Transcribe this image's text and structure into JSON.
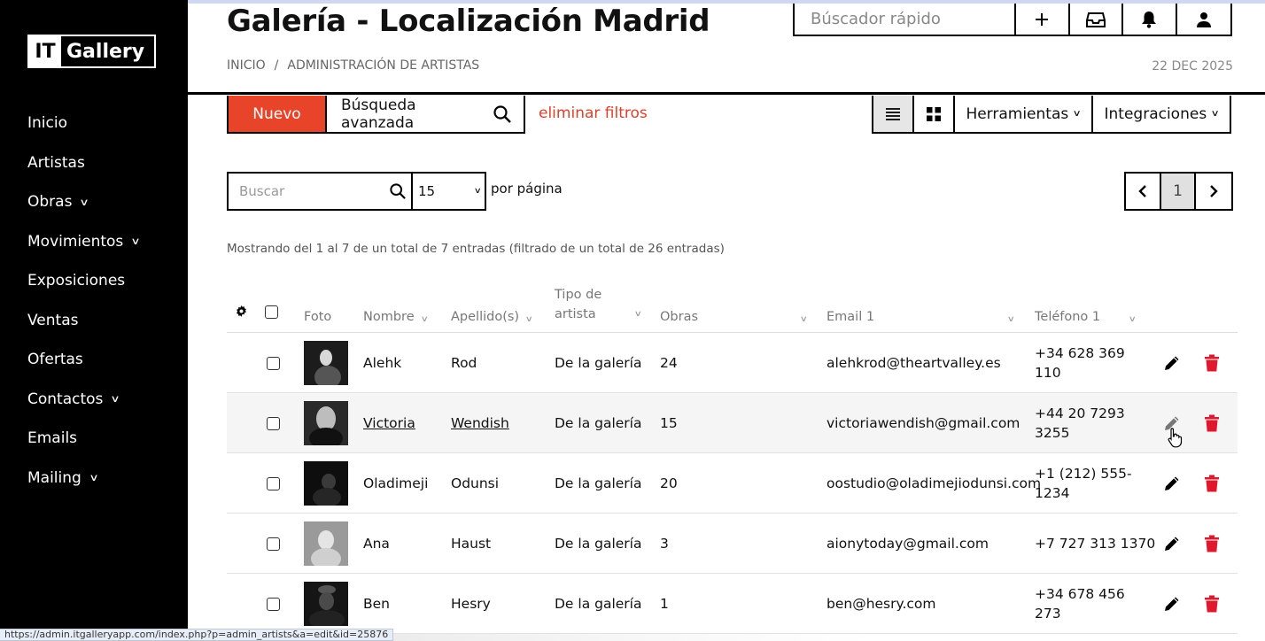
{
  "brand": {
    "logo_it": "IT",
    "logo_rest": "Gallery"
  },
  "sidebar": {
    "items": [
      {
        "label": "Inicio",
        "has_submenu": false
      },
      {
        "label": "Artistas",
        "has_submenu": false
      },
      {
        "label": "Obras",
        "has_submenu": true
      },
      {
        "label": "Movimientos",
        "has_submenu": true
      },
      {
        "label": "Exposiciones",
        "has_submenu": false
      },
      {
        "label": "Ventas",
        "has_submenu": false
      },
      {
        "label": "Ofertas",
        "has_submenu": false
      },
      {
        "label": "Contactos",
        "has_submenu": true
      },
      {
        "label": "Emails",
        "has_submenu": false
      },
      {
        "label": "Mailing",
        "has_submenu": true
      }
    ]
  },
  "header": {
    "title": "Galería - Localización Madrid",
    "breadcrumb": [
      "INICIO",
      "/",
      "ADMINISTRACIÓN DE ARTISTAS"
    ],
    "date": "22 DEC 2025",
    "quick_search_placeholder": "Búscador rápido",
    "quick_icons": [
      "plus-icon",
      "inbox-icon",
      "bell-icon",
      "user-icon"
    ]
  },
  "toolbar": {
    "new_label": "Nuevo",
    "advanced_search_label": "Búsqueda avanzada",
    "clear_filters_label": "eliminar filtros",
    "tools_label": "Herramientas",
    "integrations_label": "Integraciones",
    "active_view": "list"
  },
  "listing": {
    "search_placeholder": "Buscar",
    "per_page_value": "15",
    "per_page_label": "por página",
    "current_page": "1",
    "info": "Mostrando del 1 al 7 de un total de 7 entradas (filtrado de un total de 26 entradas)"
  },
  "table": {
    "columns": {
      "foto": "Foto",
      "nombre": "Nombre",
      "apellidos": "Apellido(s)",
      "tipo_1": "Tipo de",
      "tipo_2": "artista",
      "obras": "Obras",
      "email": "Email 1",
      "telefono": "Teléfono 1"
    },
    "rows": [
      {
        "nombre": "Alehk",
        "apellidos": "Rod",
        "tipo": "De la galería",
        "obras": "24",
        "email": "alehkrod@theartvalley.es",
        "tel_1": "+34 628 369",
        "tel_2": "110"
      },
      {
        "nombre": "Victoria",
        "apellidos": "Wendish",
        "tipo": "De la galería",
        "obras": "15",
        "email": "victoriawendish@gmail.com",
        "tel_1": "+44 20 7293",
        "tel_2": "3255"
      },
      {
        "nombre": "Oladimeji",
        "apellidos": "Odunsi",
        "tipo": "De la galería",
        "obras": "20",
        "email": "oostudio@oladimejiodunsi.com",
        "tel_1": "+1 (212) 555-",
        "tel_2": "1234"
      },
      {
        "nombre": "Ana",
        "apellidos": "Haust",
        "tipo": "De la galería",
        "obras": "3",
        "email": "aionytoday@gmail.com",
        "tel_1": "+7 727 313 1370",
        "tel_2": ""
      },
      {
        "nombre": "Ben",
        "apellidos": "Hesry",
        "tipo": "De la galería",
        "obras": "1",
        "email": "ben@hesry.com",
        "tel_1": "+34 678 456",
        "tel_2": "273"
      }
    ]
  },
  "status_url": "https://admin.itgalleryapp.com/index.php?p=admin_artists&a=edit&id=25876",
  "colors": {
    "accent": "#e8442a",
    "delete": "#e0182d",
    "sidebar": "#000000"
  }
}
